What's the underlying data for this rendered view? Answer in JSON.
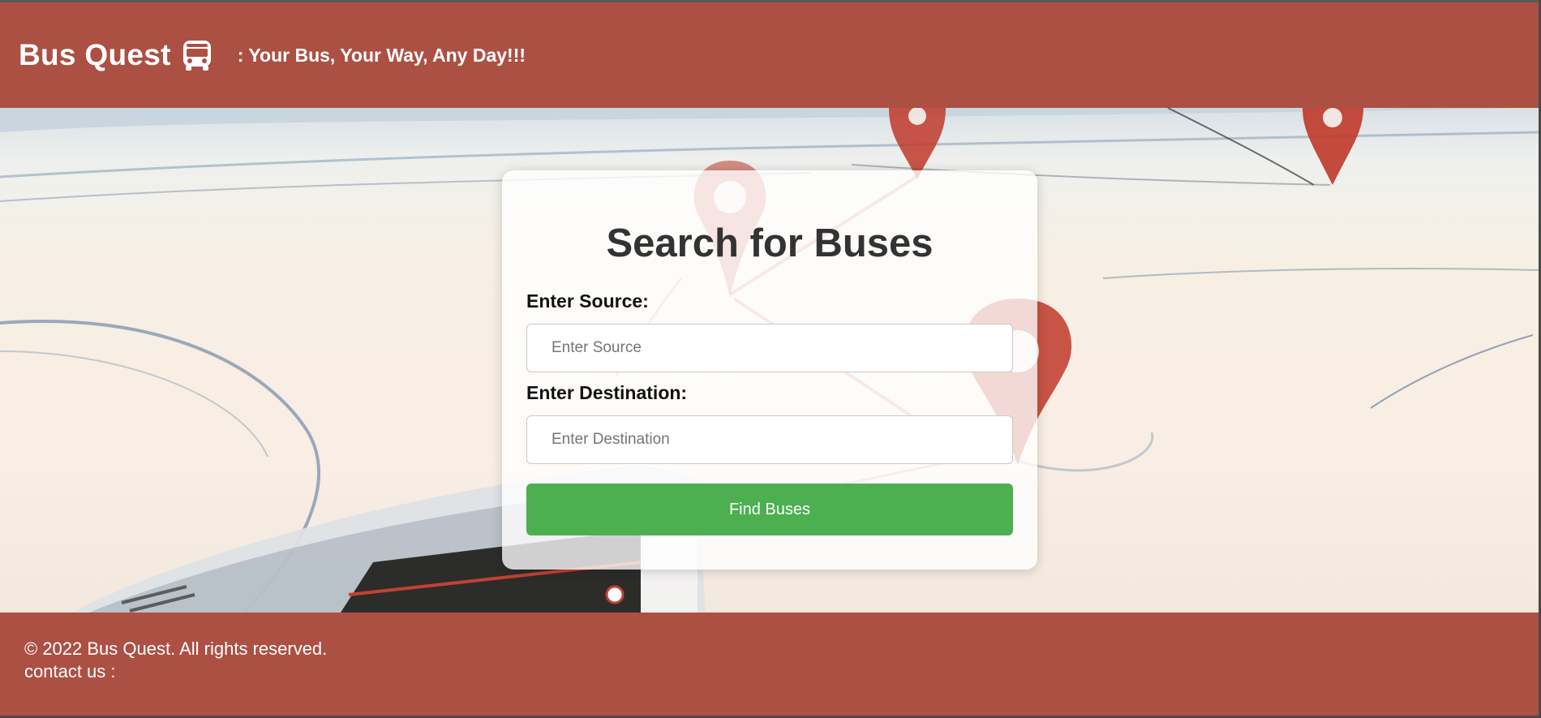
{
  "header": {
    "brand": "Bus Quest",
    "brand_icon": "bus-icon",
    "tagline": ": Your Bus, Your Way, Any Day!!!"
  },
  "search": {
    "title": "Search for Buses",
    "source_label": "Enter Source:",
    "source_placeholder": "Enter Source",
    "source_value": "",
    "destination_label": "Enter Destination:",
    "destination_placeholder": "Enter Destination",
    "destination_value": "",
    "submit_label": "Find Buses"
  },
  "footer": {
    "copyright": "© 2022 Bus Quest. All rights reserved.",
    "contact": "contact us :"
  },
  "colors": {
    "header_bg": "#ac5044",
    "footer_bg": "#ac5044",
    "button_bg": "#4caf50",
    "pin_red": "#c0392b"
  }
}
